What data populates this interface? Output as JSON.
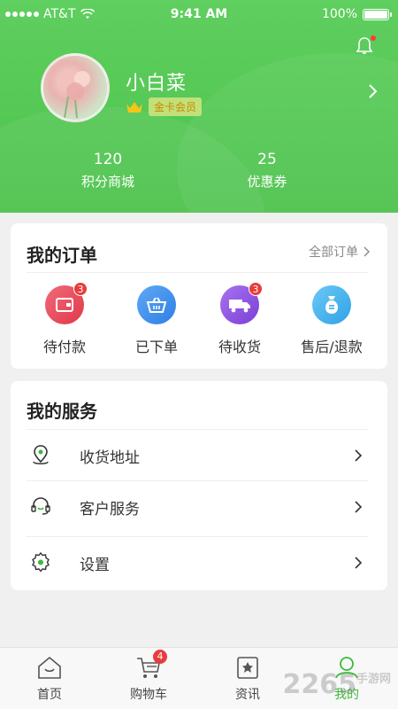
{
  "status_bar": {
    "carrier": "AT&T",
    "time": "9:41 AM",
    "battery": "100%"
  },
  "profile": {
    "username": "小白菜",
    "member_level": "金卡会员",
    "stats": [
      {
        "value": "120",
        "label": "积分商城"
      },
      {
        "value": "25",
        "label": "优惠券"
      }
    ]
  },
  "orders": {
    "title": "我的订单",
    "all_link": "全部订单",
    "items": [
      {
        "label": "待付款",
        "badge": "3",
        "icon": "wallet-icon",
        "color": "#e8505f"
      },
      {
        "label": "已下单",
        "badge": "",
        "icon": "basket-icon",
        "color": "#3e8fee"
      },
      {
        "label": "待收货",
        "badge": "3",
        "icon": "truck-icon",
        "color": "#8b4fe0"
      },
      {
        "label": "售后/退款",
        "badge": "",
        "icon": "money-bag-icon",
        "color": "#3ab0ef"
      }
    ]
  },
  "services": {
    "title": "我的服务",
    "items": [
      {
        "label": "收货地址",
        "icon": "location-pin-icon"
      },
      {
        "label": "客户服务",
        "icon": "headset-icon"
      },
      {
        "label": "设置",
        "icon": "gear-icon"
      }
    ]
  },
  "tabbar": {
    "items": [
      {
        "label": "首页",
        "icon": "home-icon",
        "active": false
      },
      {
        "label": "购物车",
        "icon": "cart-icon",
        "badge": "4",
        "active": false
      },
      {
        "label": "资讯",
        "icon": "news-icon",
        "active": false
      },
      {
        "label": "我的",
        "icon": "profile-icon",
        "active": true
      }
    ]
  },
  "watermark": {
    "main": "2265",
    "sub": "手游网"
  },
  "colors": {
    "primary_green": "#4cc24c",
    "badge_red": "#e83c3c",
    "gold": "#c98a00"
  }
}
